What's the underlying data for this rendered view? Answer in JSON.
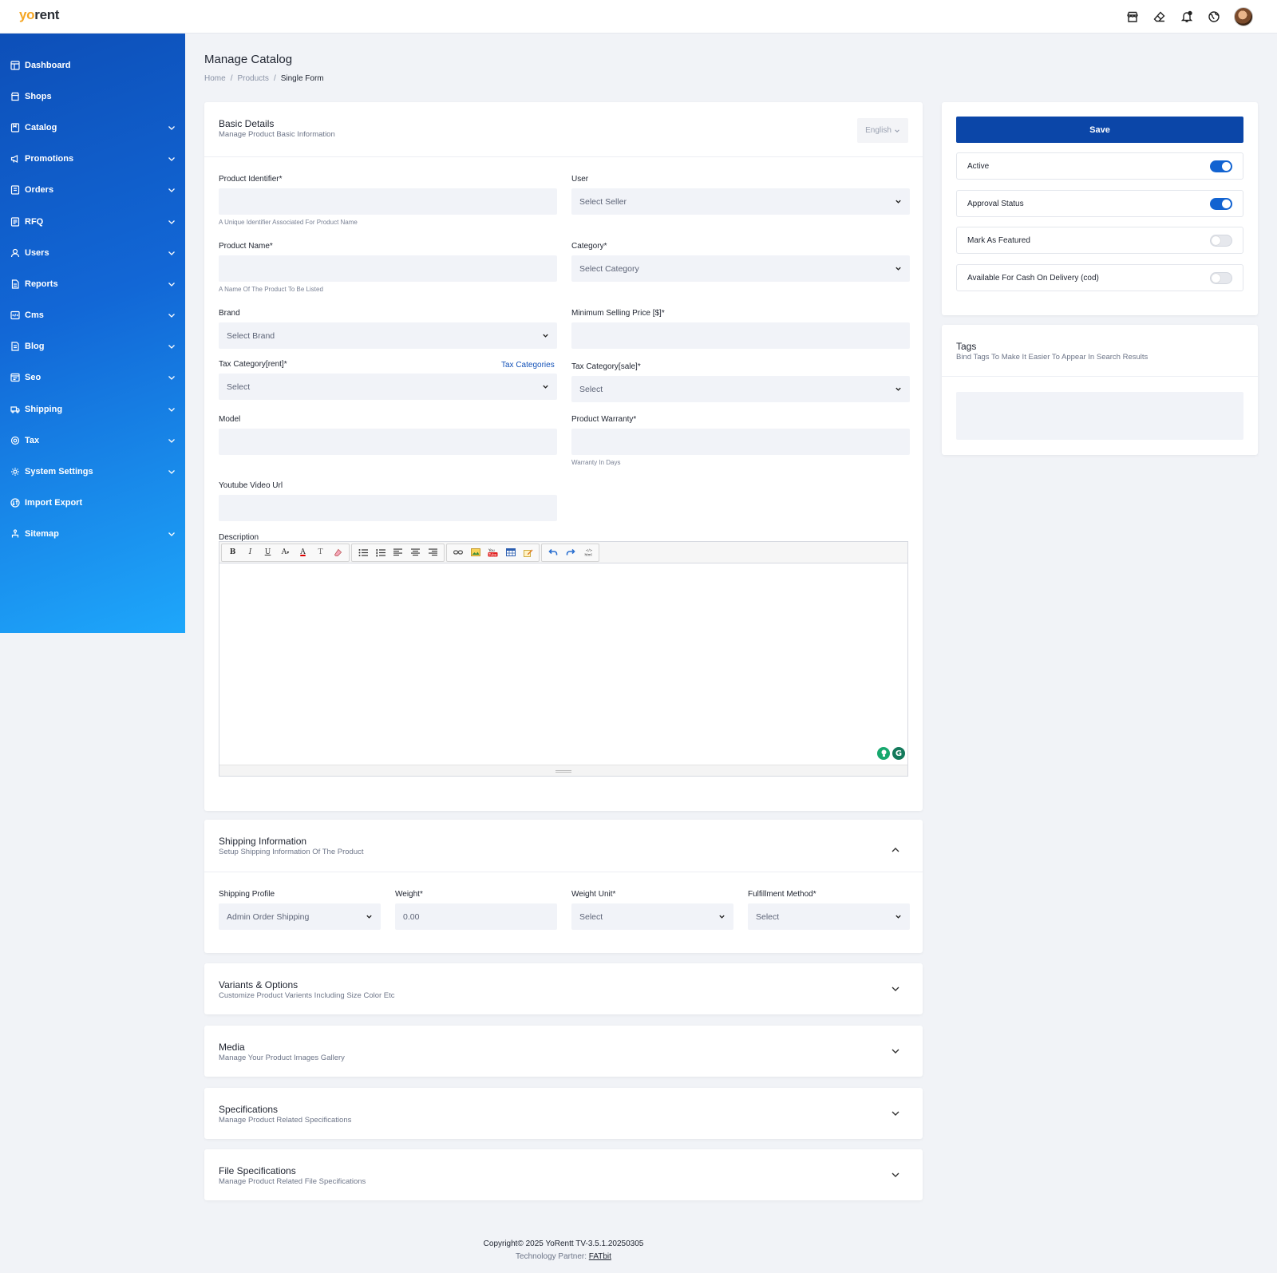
{
  "brand": {
    "logo_part1": "yo",
    "logo_part2": "rent"
  },
  "header_icons": [
    "store-icon",
    "eraser-icon",
    "bell-icon",
    "globe-icon"
  ],
  "sidebar": {
    "items": [
      {
        "label": "Dashboard",
        "icon": "dashboard-icon",
        "expandable": false
      },
      {
        "label": "Shops",
        "icon": "shop-icon",
        "expandable": false
      },
      {
        "label": "Catalog",
        "icon": "catalog-icon",
        "expandable": true
      },
      {
        "label": "Promotions",
        "icon": "megaphone-icon",
        "expandable": true
      },
      {
        "label": "Orders",
        "icon": "orders-icon",
        "expandable": true
      },
      {
        "label": "RFQ",
        "icon": "rfq-icon",
        "expandable": true
      },
      {
        "label": "Users",
        "icon": "user-icon",
        "expandable": true
      },
      {
        "label": "Reports",
        "icon": "reports-icon",
        "expandable": true
      },
      {
        "label": "Cms",
        "icon": "cms-icon",
        "expandable": true
      },
      {
        "label": "Blog",
        "icon": "blog-icon",
        "expandable": true
      },
      {
        "label": "Seo",
        "icon": "seo-icon",
        "expandable": true
      },
      {
        "label": "Shipping",
        "icon": "truck-icon",
        "expandable": true
      },
      {
        "label": "Tax",
        "icon": "tax-icon",
        "expandable": true
      },
      {
        "label": "System Settings",
        "icon": "gear-icon",
        "expandable": true
      },
      {
        "label": "Import Export",
        "icon": "import-export-icon",
        "expandable": false
      },
      {
        "label": "Sitemap",
        "icon": "sitemap-icon",
        "expandable": true
      }
    ]
  },
  "page": {
    "title": "Manage Catalog",
    "breadcrumb": [
      "Home",
      "Products",
      "Single Form"
    ]
  },
  "basic": {
    "title": "Basic Details",
    "subtitle": "Manage Product Basic Information",
    "language": "English",
    "product_identifier": {
      "label": "Product Identifier*",
      "value": "",
      "hint": "A Unique Identifier Associated For Product Name"
    },
    "user": {
      "label": "User",
      "value": "Select Seller"
    },
    "product_name": {
      "label": "Product Name*",
      "value": "",
      "hint": "A Name Of The Product To Be Listed"
    },
    "category": {
      "label": "Category*",
      "value": "Select Category"
    },
    "brand": {
      "label": "Brand",
      "value": "Select Brand"
    },
    "min_price": {
      "label": "Minimum Selling Price [$]*",
      "value": ""
    },
    "tax_rent": {
      "label": "Tax Category[rent]*",
      "value": "Select",
      "link": "Tax Categories"
    },
    "tax_sale": {
      "label": "Tax Category[sale]*",
      "value": "Select"
    },
    "model": {
      "label": "Model",
      "value": ""
    },
    "warranty": {
      "label": "Product Warranty*",
      "value": "",
      "hint": "Warranty In Days"
    },
    "youtube": {
      "label": "Youtube Video Url",
      "value": ""
    },
    "description": {
      "label": "Description"
    }
  },
  "shipping": {
    "title": "Shipping Information",
    "subtitle": "Setup Shipping Information Of The Product",
    "profile": {
      "label": "Shipping Profile",
      "value": "Admin Order Shipping"
    },
    "weight": {
      "label": "Weight*",
      "value": "0.00"
    },
    "weight_unit": {
      "label": "Weight Unit*",
      "value": "Select"
    },
    "fulfillment": {
      "label": "Fulfillment Method*",
      "value": "Select"
    }
  },
  "sections": [
    {
      "title": "Variants & Options",
      "subtitle": "Customize Product Varients Including Size Color Etc"
    },
    {
      "title": "Media",
      "subtitle": "Manage Your Product Images Gallery"
    },
    {
      "title": "Specifications",
      "subtitle": "Manage Product Related Specifications"
    },
    {
      "title": "File Specifications",
      "subtitle": "Manage Product Related File Specifications"
    }
  ],
  "side": {
    "save_label": "Save",
    "toggles": [
      {
        "label": "Active",
        "on": true
      },
      {
        "label": "Approval Status",
        "on": true
      },
      {
        "label": "Mark As Featured",
        "on": false
      },
      {
        "label": "Available For Cash On Delivery (cod)",
        "on": false
      }
    ],
    "tags": {
      "title": "Tags",
      "subtitle": "Bind Tags To Make It Easier To Appear In Search Results",
      "value": ""
    }
  },
  "footer": {
    "copyright": "Copyright© 2025 YoRentt TV-3.5.1.20250305",
    "partner_label": "Technology Partner:",
    "partner_link": "FATbit"
  },
  "colors": {
    "accent": "#0b46a8",
    "sidebar_top": "#0d4fb8",
    "sidebar_bottom": "#1ea7fb",
    "toggle_on": "#1263d1"
  }
}
